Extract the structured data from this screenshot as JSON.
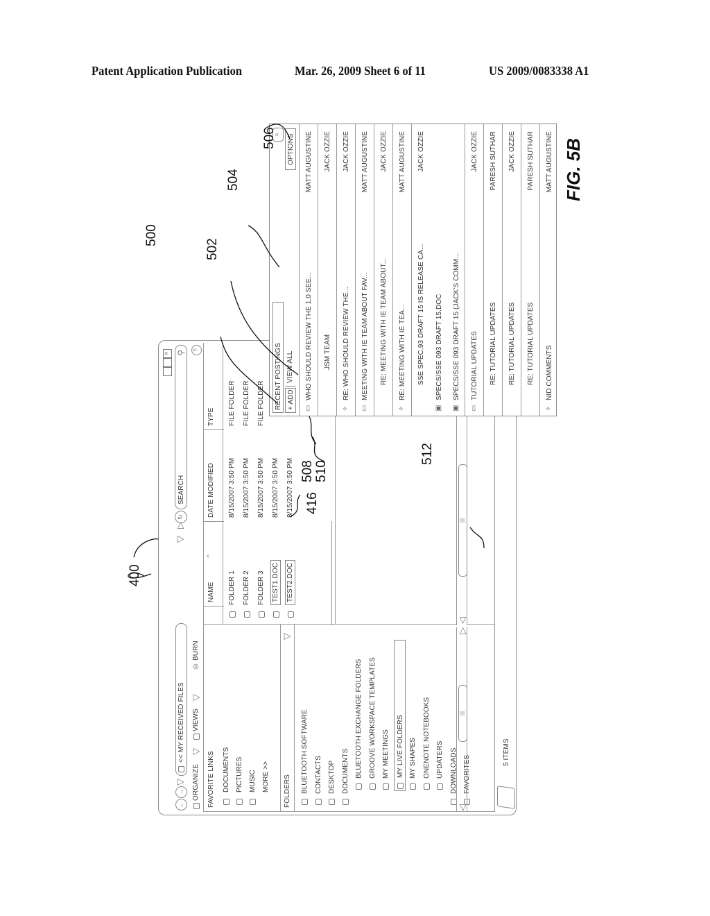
{
  "header": {
    "left": "Patent Application Publication",
    "middle": "Mar. 26, 2009  Sheet 6 of 11",
    "right": "US 2009/0083338 A1"
  },
  "figure_label": "FIG. 5B",
  "reference_numerals": {
    "window": "400",
    "selected_files": "416",
    "panel": "500",
    "add": "502",
    "view_all": "504",
    "options": "506",
    "thread": "508",
    "workspace": "510",
    "file_group": "512"
  },
  "explorer": {
    "address": "<< MY RECEIVED FILES",
    "search_placeholder": "SEARCH",
    "toolbar": {
      "organize": "ORGANIZE",
      "views": "VIEWS",
      "burn": "BURN"
    },
    "favorite_links_title": "FAVORITE LINKS",
    "favorite_links": [
      "DOCUMENTS",
      "PICTURES",
      "MUSIC",
      "MORE >>"
    ],
    "folders_title": "FOLDERS",
    "folders": [
      {
        "label": "BLUETOOTH SOFTWARE",
        "level": 0
      },
      {
        "label": "CONTACTS",
        "level": 0
      },
      {
        "label": "DESKTOP",
        "level": 0
      },
      {
        "label": "DOCUMENTS",
        "level": 0
      },
      {
        "label": "BLUETOOTH EXCHANGE FOLDERS",
        "level": 1
      },
      {
        "label": "GROOVE WORKSPACE TEMPLATES",
        "level": 1
      },
      {
        "label": "MY MEETINGS",
        "level": 1
      },
      {
        "label": "MY LIVE FOLDERS",
        "level": 1,
        "selected": true
      },
      {
        "label": "MY SHAPES",
        "level": 1
      },
      {
        "label": "ONENOTE NOTEBOOKS",
        "level": 1
      },
      {
        "label": "UPDATERS",
        "level": 1
      },
      {
        "label": "DOWNLOADS",
        "level": 0
      },
      {
        "label": "FAVORITES",
        "level": 0
      }
    ],
    "columns": [
      "NAME",
      "DATE MODIFIED",
      "TYPE"
    ],
    "files": [
      {
        "name": "FOLDER 1",
        "date": "8/15/2007 3:50 PM",
        "type": "FILE FOLDER"
      },
      {
        "name": "FOLDER 2",
        "date": "8/15/2007 3:50 PM",
        "type": "FILE FOLDER"
      },
      {
        "name": "FOLDER 3",
        "date": "8/15/2007 3:50 PM",
        "type": "FILE FOLDER"
      },
      {
        "name": "TEST1.DOC",
        "date": "8/15/2007 3:50 PM",
        "type": ""
      },
      {
        "name": "TEST2.DOC",
        "date": "8/15/2007 3:50 PM",
        "type": ""
      }
    ],
    "status": "5 ITEMS"
  },
  "postings": {
    "title": "RECENT POSTINGS",
    "add_label": "+ ADD",
    "view_all_label": "VIEW ALL",
    "options_label": "OPTIONS",
    "items": [
      {
        "text": "WHO SHOULD REVIEW THE 1.0 SEE...",
        "author": "MATT AUGUSTINE",
        "icon": "thread",
        "indent": 0
      },
      {
        "text": "JSM TEAM",
        "author": "JACK OZZIE",
        "icon": "",
        "indent": 2
      },
      {
        "text": "RE: WHO SHOULD REVIEW THE...",
        "author": "JACK OZZIE",
        "icon": "reply",
        "indent": 0
      },
      {
        "text": "MEETING WITH IE TEAM ABOUT FAV...",
        "author": "MATT AUGUSTINE",
        "icon": "thread",
        "indent": 0
      },
      {
        "text": "RE: MEETING WITH IE TEAM ABOUT...",
        "author": "JACK OZZIE",
        "icon": "",
        "indent": 1
      },
      {
        "text": "RE: MEETING WITH IE TEA...",
        "author": "MATT AUGUSTINE",
        "icon": "reply",
        "indent": 0
      },
      {
        "text": "SSE SPEC.93 DRAFT 15 IS RELEASE CA...",
        "author": "JACK OZZIE",
        "icon": "",
        "indent": 1
      },
      {
        "text": "SPECS/SSE 093 DRAFT 15.DOC",
        "author": "",
        "icon": "doc",
        "indent": 0,
        "group": true
      },
      {
        "text": "SPECS/SSE 093 DRAFT 15 (JACK'S COMM...",
        "author": "",
        "icon": "doc",
        "indent": 0,
        "group": true
      },
      {
        "text": "TUTORIAL UPDATES",
        "author": "JACK OZZIE",
        "icon": "thread",
        "indent": 0
      },
      {
        "text": "RE: TUTORIAL UPDATES",
        "author": "PARESH SUTHAR",
        "icon": "",
        "indent": 1
      },
      {
        "text": "RE: TUTORIAL UPDATES",
        "author": "JACK OZZIE",
        "icon": "",
        "indent": 1
      },
      {
        "text": "RE: TUTORIAL UPDATES",
        "author": "PARESH SUTHAR",
        "icon": "",
        "indent": 1
      },
      {
        "text": "NID COMMENTS",
        "author": "MATT AUGUSTINE",
        "icon": "reply",
        "indent": 0
      }
    ]
  }
}
